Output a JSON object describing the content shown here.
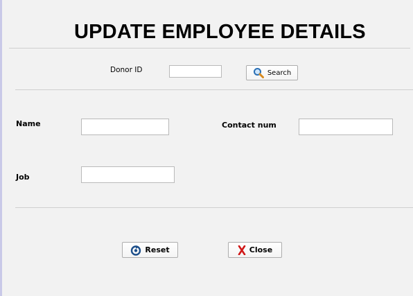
{
  "header": {
    "title": "UPDATE EMPLOYEE DETAILS"
  },
  "search": {
    "label": "Donor ID",
    "value": "",
    "button_label": "Search",
    "button_icon": "magnifier-icon"
  },
  "form": {
    "name_label": "Name",
    "name_value": "",
    "contact_label": "Contact num",
    "contact_value": "",
    "job_label": "Job",
    "job_value": ""
  },
  "actions": {
    "reset_label": "Reset",
    "reset_icon": "reset-icon",
    "close_label": "Close",
    "close_icon": "red-x-icon"
  },
  "colors": {
    "background": "#f2f2f2",
    "search_icon": "#2a6fb5",
    "close_icon": "#d01818"
  }
}
